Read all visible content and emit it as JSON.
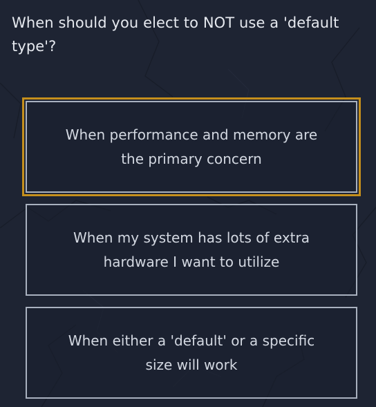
{
  "question": {
    "text": "When should you elect to NOT use a 'default type'?"
  },
  "answers": [
    {
      "label": "When performance and memory are the primary concern",
      "selected": true
    },
    {
      "label": "When my system has lots of extra hardware I want to utilize",
      "selected": false
    },
    {
      "label": "When either a 'default' or a specific size will work",
      "selected": false
    }
  ],
  "colors": {
    "background": "#1e2433",
    "answer_border": "#a9b1bf",
    "selected_outline": "#c58f1c",
    "text": "#e6e9ef"
  }
}
